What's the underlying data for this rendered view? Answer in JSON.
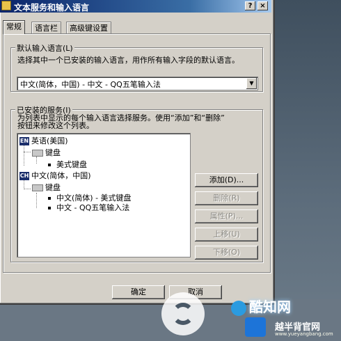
{
  "window": {
    "title": "文本服务和输入语言",
    "help_label": "?",
    "close_label": "×"
  },
  "tabs": [
    {
      "label": "常规"
    },
    {
      "label": "语言栏"
    },
    {
      "label": "高级键设置"
    }
  ],
  "default_language": {
    "group_label": "默认输入语言(L)",
    "description": "选择其中一个已安装的输入语言，用作所有输入字段的默认语言。",
    "selected_value": "中文(简体，中国) - 中文 - QQ五笔输入法"
  },
  "installed_services": {
    "group_label": "已安装的服务(I)",
    "description_line1": "为列表中显示的每个输入语言选择服务。使用“添加”和“删除”",
    "description_line2": "按钮来修改这个列表。",
    "tree": [
      {
        "badge": "EN",
        "label": "英语(美国)"
      },
      {
        "label": "键盘"
      },
      {
        "label": "美式键盘"
      },
      {
        "badge": "CH",
        "label": "中文(简体，中国)"
      },
      {
        "label": "键盘"
      },
      {
        "label": "中文(简体) - 美式键盘"
      },
      {
        "label": "中文 - QQ五笔输入法"
      }
    ],
    "buttons": {
      "add": "添加(D)...",
      "remove": "删除(R)",
      "properties": "属性(P)...",
      "move_up": "上移(U)",
      "move_down": "下移(O)"
    }
  },
  "footer": {
    "ok": "确定",
    "cancel": "取消"
  },
  "watermark": {
    "logo_text": "酷知网",
    "sub_text": "越半背官网",
    "url": "www.yueyangbang.com"
  },
  "colors": {
    "titlebar": "#0a246a",
    "dialog": "#d4d0c8"
  }
}
